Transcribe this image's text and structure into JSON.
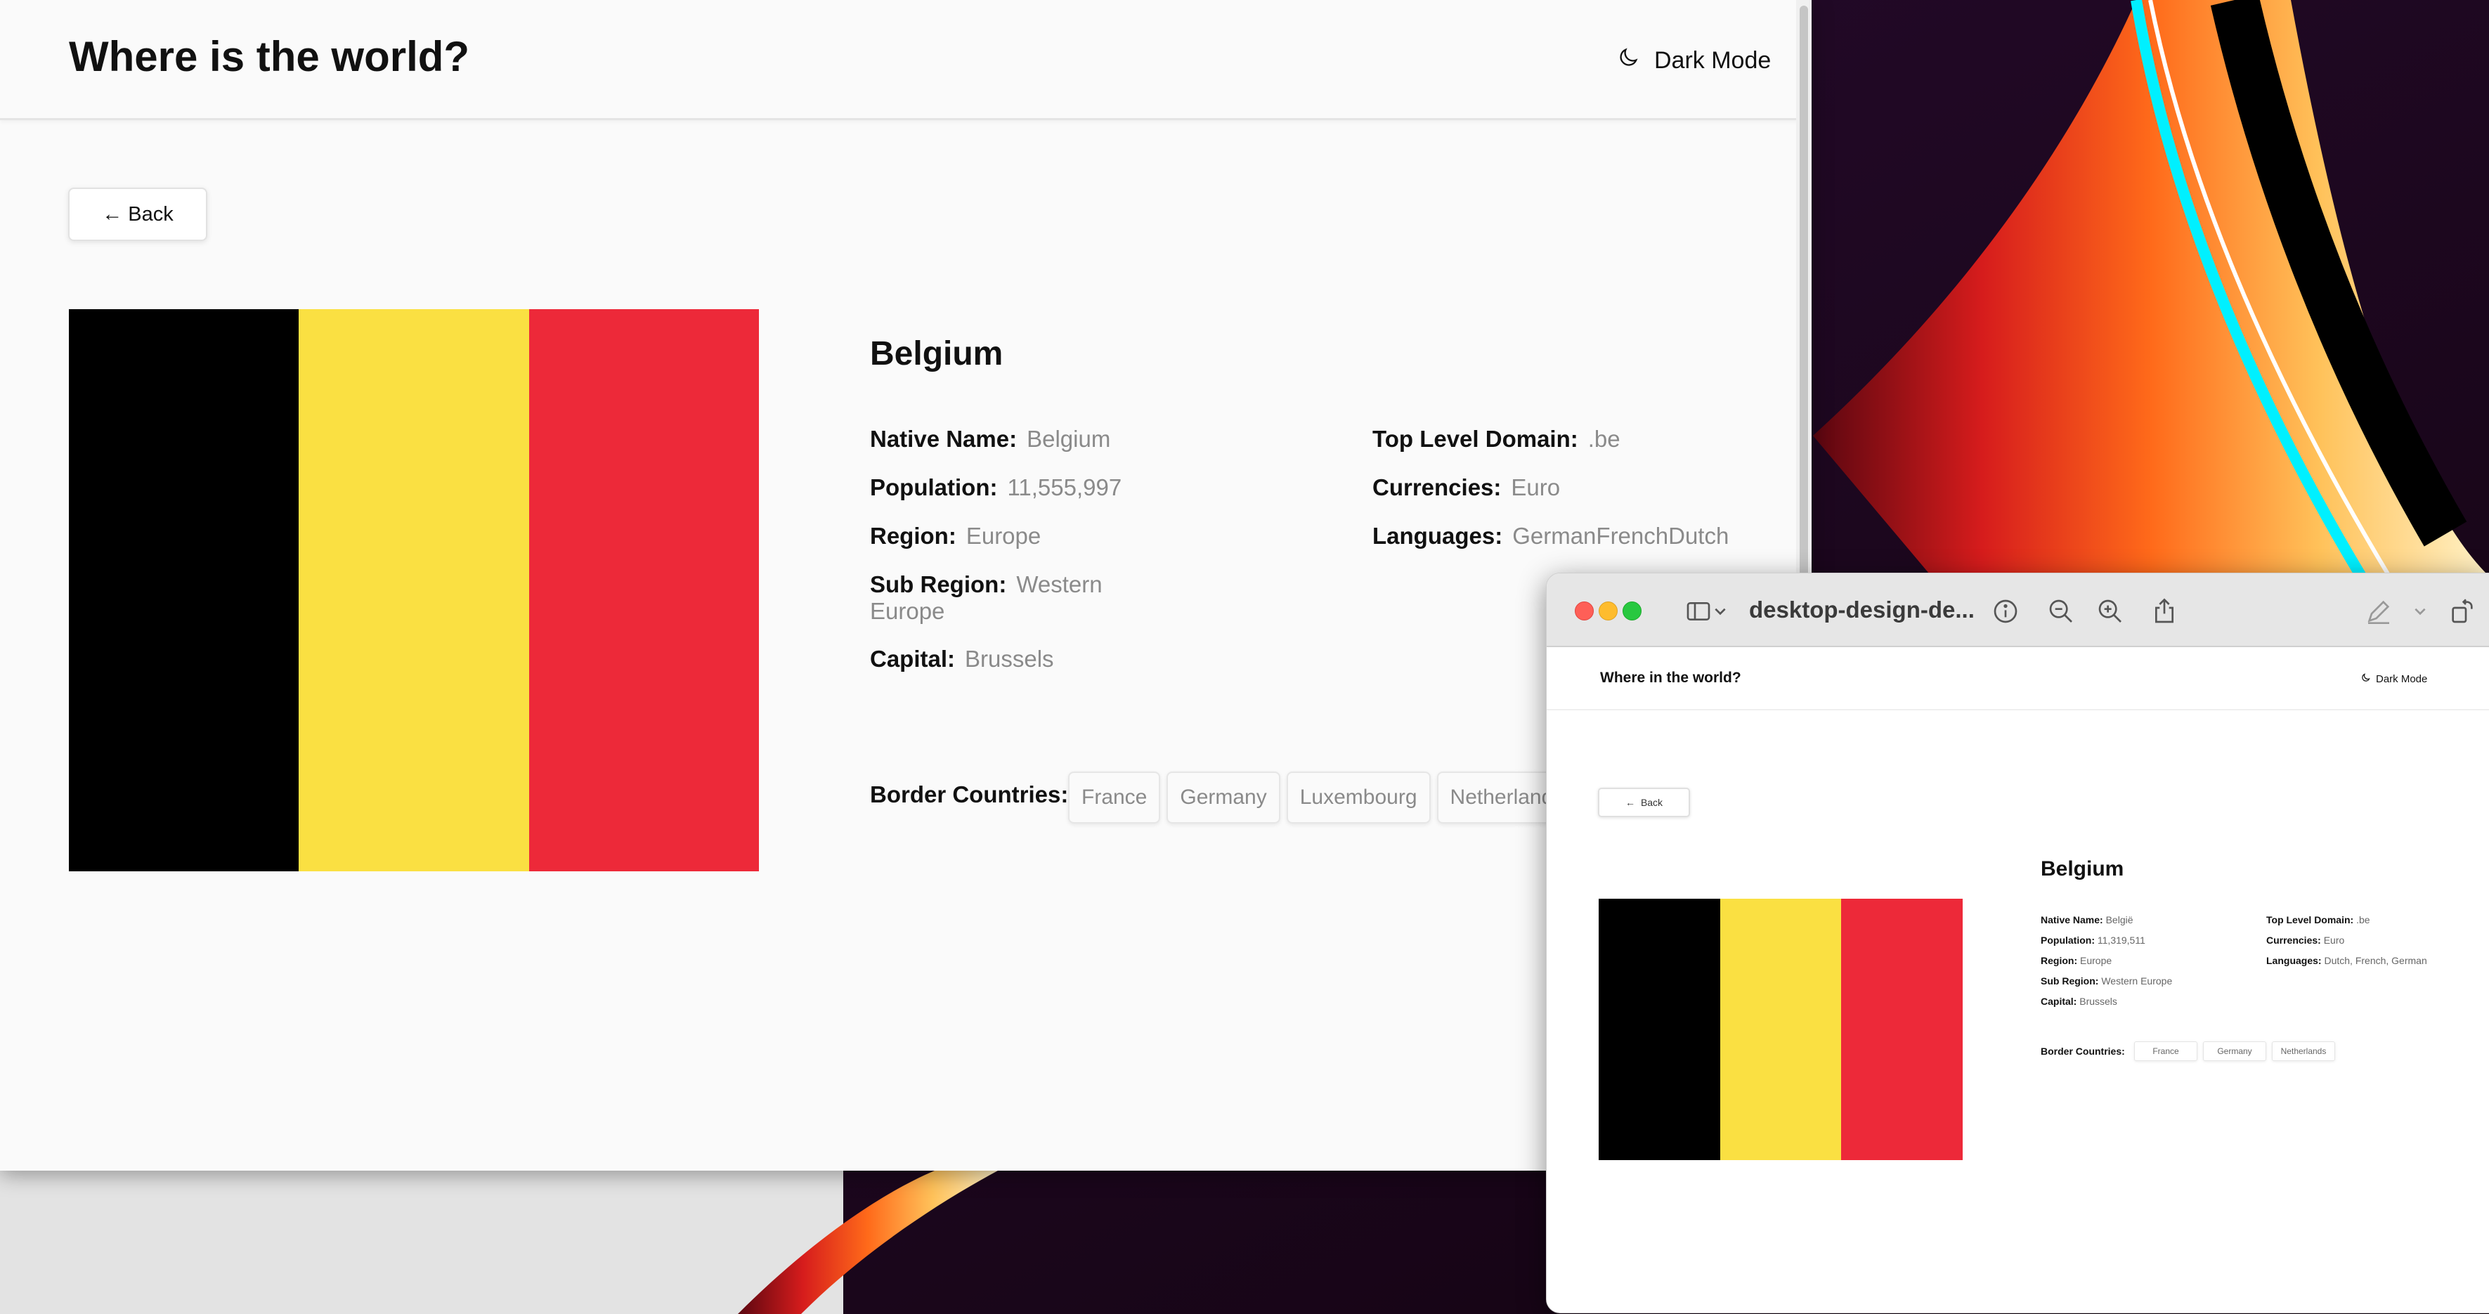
{
  "app": {
    "title": "Where is the world?",
    "dark_mode_label": "Dark Mode",
    "back_label": "← Back"
  },
  "country": {
    "name": "Belgium",
    "left_fields": [
      {
        "label": "Native Name:",
        "value": "Belgium"
      },
      {
        "label": "Population:",
        "value": "11,555,997"
      },
      {
        "label": "Region:",
        "value": "Europe"
      },
      {
        "label": "Sub Region:",
        "value": "Western Europe"
      },
      {
        "label": "Capital:",
        "value": "Brussels"
      }
    ],
    "right_fields": [
      {
        "label": "Top Level Domain:",
        "value": ".be"
      },
      {
        "label": "Currencies:",
        "value": "Euro"
      },
      {
        "label": "Languages:",
        "value": "GermanFrenchDutch"
      }
    ],
    "border_label": "Border Countries:",
    "border_countries": [
      "France",
      "Germany",
      "Luxembourg",
      "Netherlands"
    ],
    "flag_colors": [
      "#000000",
      "#fae042",
      "#ed2939"
    ]
  },
  "preview": {
    "filename": "desktop-design-de...",
    "page": {
      "title": "Where in the world?",
      "dark_mode_label": "Dark Mode",
      "back_label": "Back",
      "country_name": "Belgium",
      "left_fields": [
        {
          "label": "Native Name:",
          "value": "België"
        },
        {
          "label": "Population:",
          "value": "11,319,511"
        },
        {
          "label": "Region:",
          "value": "Europe"
        },
        {
          "label": "Sub Region:",
          "value": "Western Europe"
        },
        {
          "label": "Capital:",
          "value": "Brussels"
        }
      ],
      "right_fields": [
        {
          "label": "Top Level Domain:",
          "value": ".be"
        },
        {
          "label": "Currencies:",
          "value": "Euro"
        },
        {
          "label": "Languages:",
          "value": "Dutch, French, German"
        }
      ],
      "border_label": "Border Countries:",
      "border_countries": [
        "France",
        "Germany",
        "Netherlands"
      ]
    }
  },
  "icons": {
    "dark_mode": "moon-icon",
    "preview_toolbar": [
      "sidebar-toggle-icon",
      "chevron-down-icon",
      "info-icon",
      "zoom-out-icon",
      "zoom-in-icon",
      "share-icon",
      "markup-pen-icon",
      "chevron-down-icon",
      "rotate-icon",
      "markup-circle-icon",
      "search-icon"
    ]
  }
}
